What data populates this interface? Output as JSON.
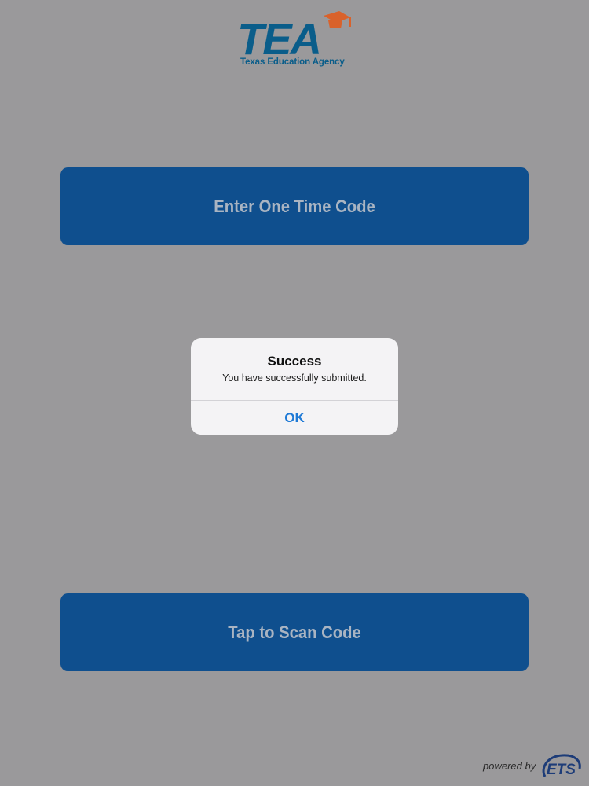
{
  "logo": {
    "wordmark": "TEA",
    "subtitle": "Texas Education Agency",
    "colors": {
      "primary": "#0a5d8a",
      "accent": "#d9622b"
    }
  },
  "buttons": {
    "enter_code": "Enter One Time Code",
    "scan_code": "Tap to Scan Code"
  },
  "alert": {
    "title": "Success",
    "message": "You have successfully submitted.",
    "ok_label": "OK"
  },
  "footer": {
    "powered_by": "powered by",
    "brand": "ETS"
  },
  "colors": {
    "background_dimmed": "#9a999b",
    "button_bg": "#0f4f8e",
    "button_text": "#a9b4c2",
    "alert_bg": "#f4f3f5",
    "alert_action": "#1f7ad6"
  }
}
